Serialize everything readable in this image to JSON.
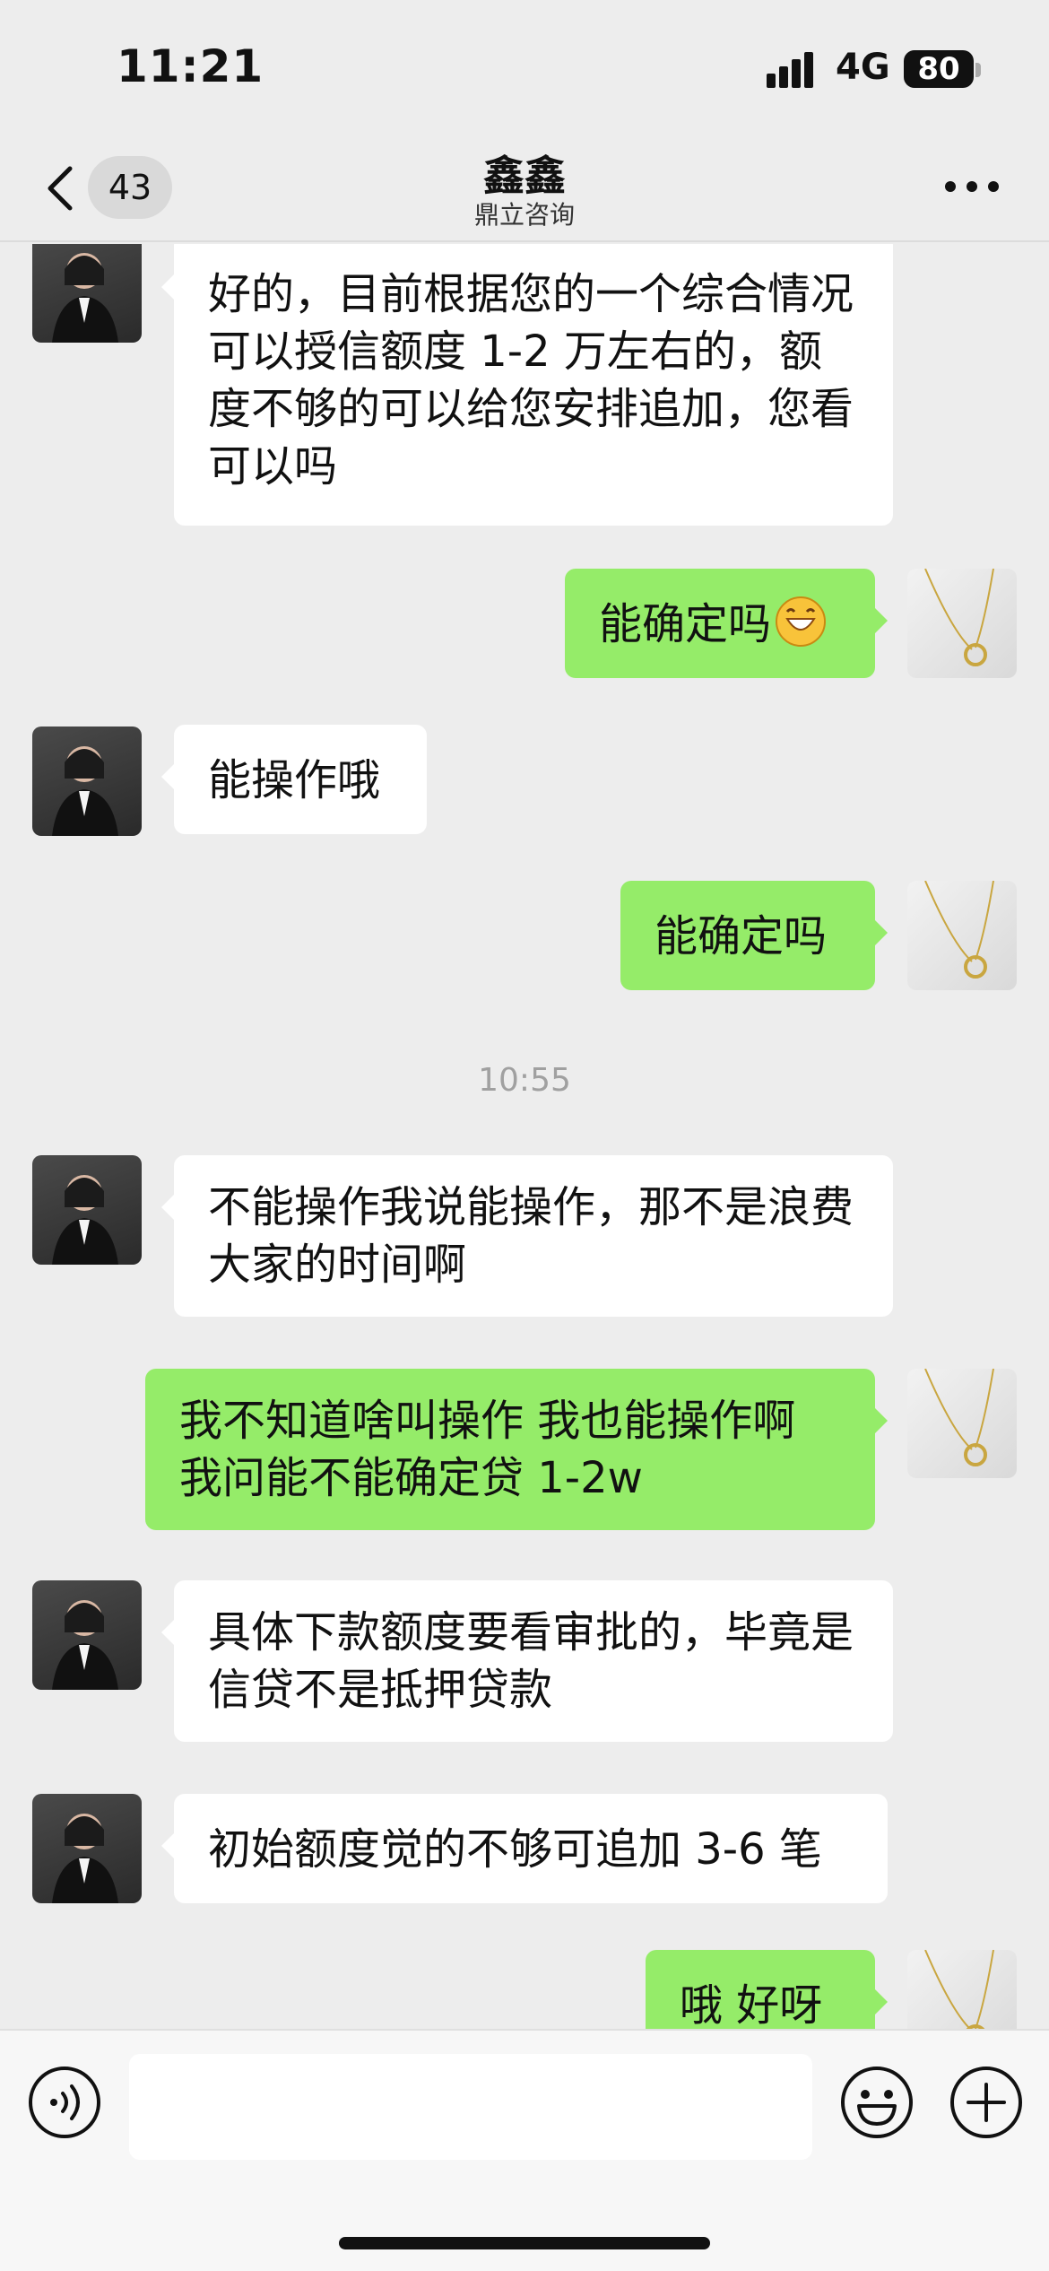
{
  "status_bar": {
    "time": "11:21",
    "network": "4G",
    "battery": "80"
  },
  "nav": {
    "back_count": "43",
    "title": "鑫鑫",
    "subtitle": "鼎立咨询"
  },
  "messages": [
    {
      "from": "her",
      "text": "好的，目前根据您的一个综合情况可以授信额度 1-2 万左右的，额度不够的可以给您安排追加，您看可以吗"
    },
    {
      "from": "me",
      "text": "能确定吗",
      "emoji": "grinning-emoji"
    },
    {
      "from": "her",
      "text": "能操作哦"
    },
    {
      "from": "me",
      "text": "能确定吗"
    },
    {
      "from": "system",
      "text": "10:55"
    },
    {
      "from": "her",
      "text": "不能操作我说能操作，那不是浪费大家的时间啊"
    },
    {
      "from": "me",
      "text": "我不知道啥叫操作 我也能操作啊 我问能不能确定贷 1-2w"
    },
    {
      "from": "her",
      "text": "具体下款额度要看审批的，毕竟是信贷不是抵押贷款"
    },
    {
      "from": "her",
      "text": "初始额度觉的不够可追加 3-6 笔"
    },
    {
      "from": "me",
      "text": "哦 好呀"
    }
  ],
  "input_bar": {
    "text_value": ""
  },
  "colors": {
    "background": "#ededed",
    "my_bubble": "#95ec69",
    "their_bubble": "#ffffff"
  },
  "icons": [
    "back-icon",
    "more-icon",
    "voice-icon",
    "emoji-icon",
    "plus-icon"
  ]
}
